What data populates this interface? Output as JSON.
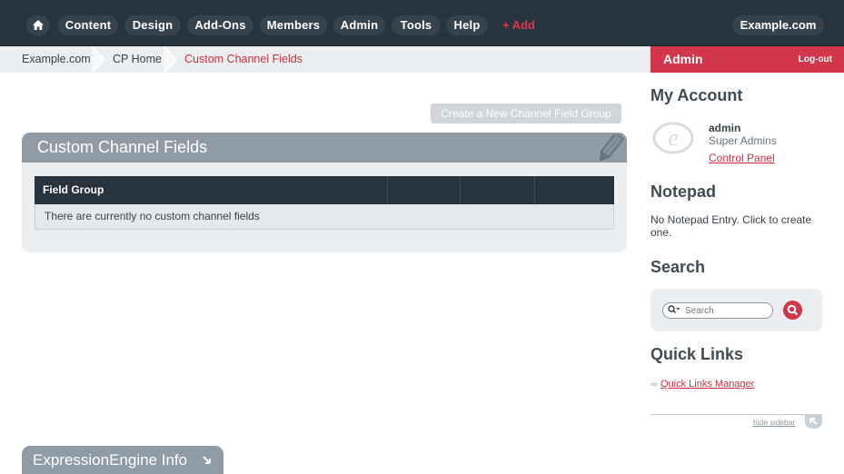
{
  "nav": {
    "items": [
      "Content",
      "Design",
      "Add-Ons",
      "Members",
      "Admin",
      "Tools",
      "Help"
    ],
    "add_label": "+ Add",
    "site_name": "Example.com"
  },
  "breadcrumb": {
    "items": [
      "Example.com",
      "CP Home"
    ],
    "current": "Custom Channel Fields"
  },
  "sidebar": {
    "header_title": "Admin",
    "logout_label": "Log-out",
    "my_account": {
      "title": "My Account",
      "username": "admin",
      "group": "Super Admins",
      "control_panel_link": "Control Panel"
    },
    "notepad": {
      "title": "Notepad",
      "text": "No Notepad Entry. Click to create one."
    },
    "search": {
      "title": "Search",
      "placeholder": "Search"
    },
    "quick_links": {
      "title": "Quick Links",
      "manager_link": "Quick Links Manager"
    },
    "hide_sidebar_label": "hide sidebar"
  },
  "main": {
    "create_button": "Create a New Channel Field Group",
    "panel_title": "Custom Channel Fields",
    "table": {
      "columns": [
        "Field Group",
        "",
        "",
        ""
      ],
      "empty_message": "There are currently no custom channel fields"
    },
    "ee_info_title": "ExpressionEngine Info"
  },
  "colors": {
    "nav_bg": "#27343d",
    "accent_red": "#d2364a",
    "panel_header": "#8f9ca6",
    "panel_bg": "#eceff1"
  }
}
